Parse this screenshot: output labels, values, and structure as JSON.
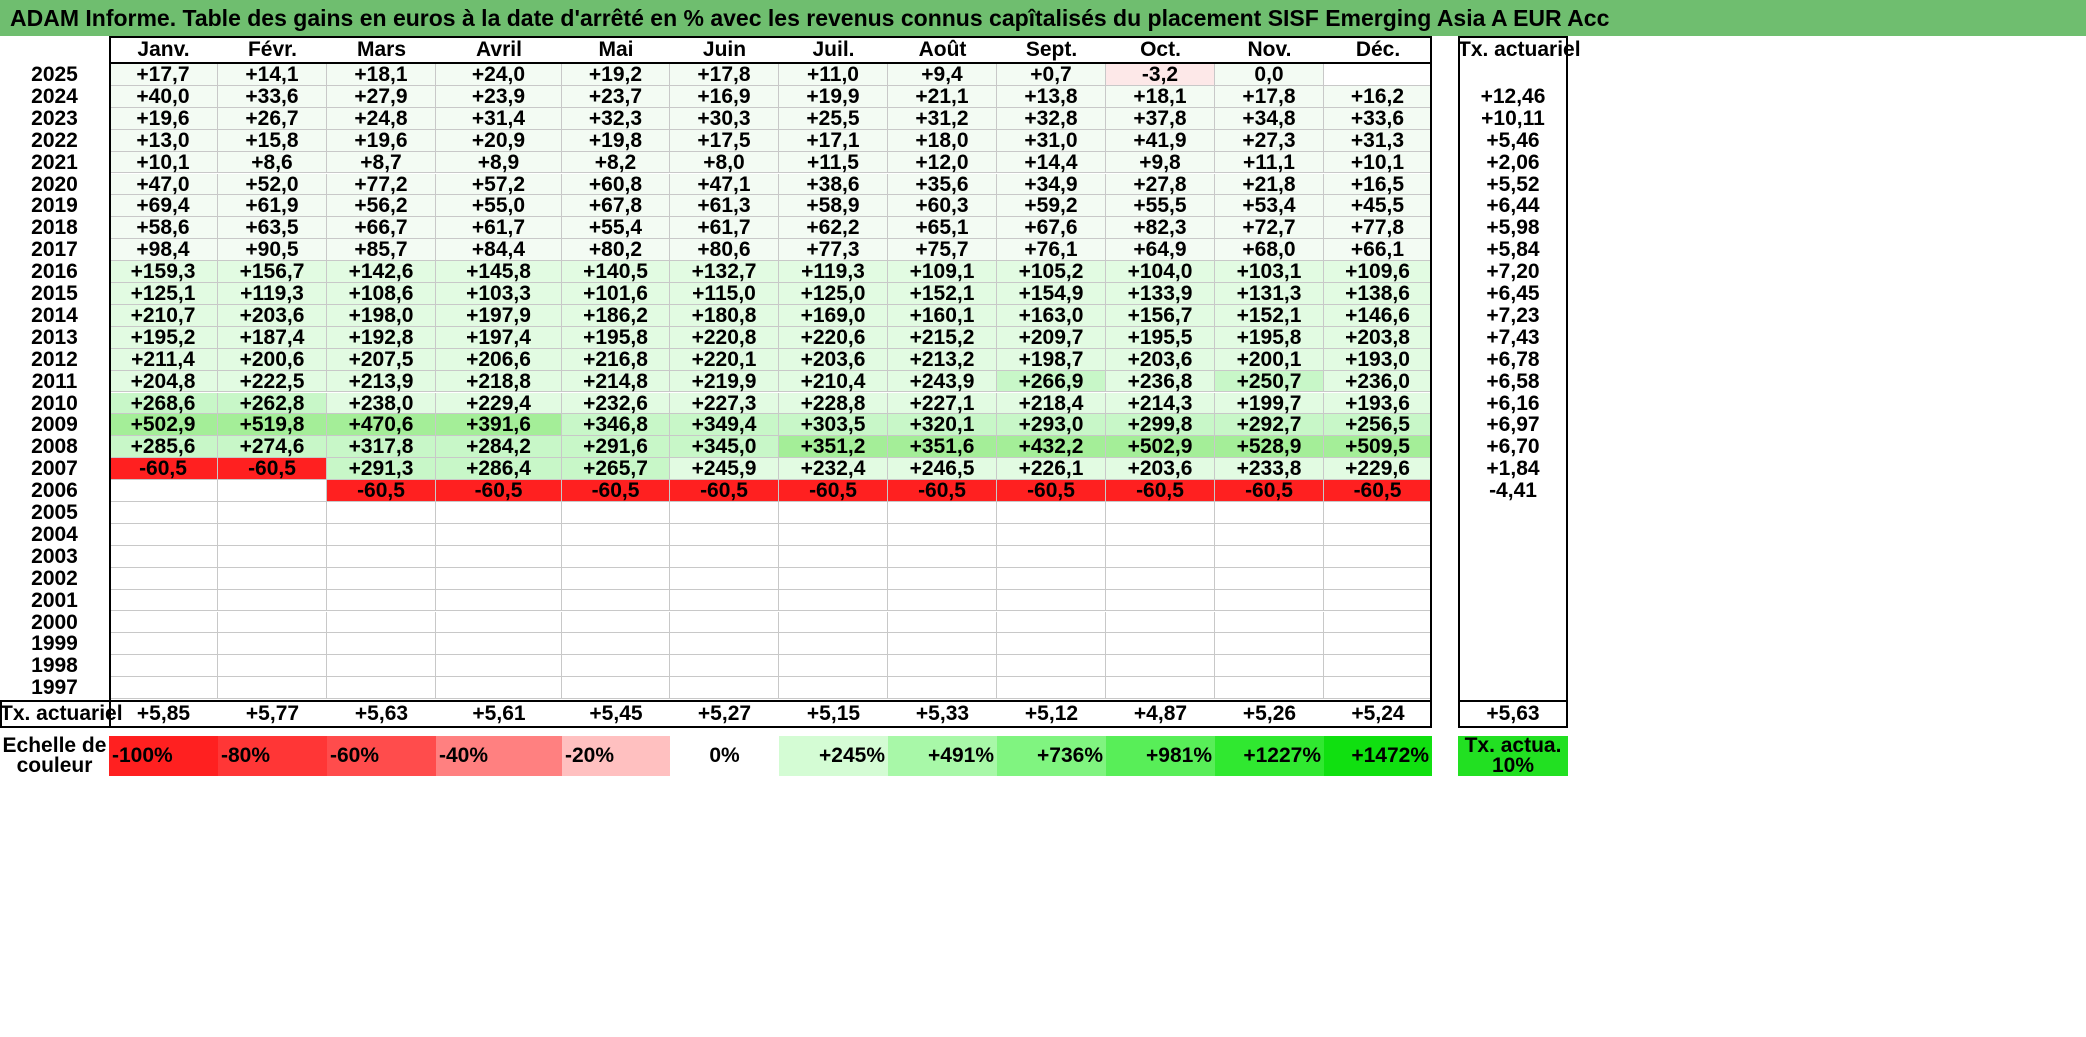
{
  "title": "ADAM Informe. Table des gains en euros à la date d'arrêté en % avec les revenus connus capîtalisés du placement SISF Emerging Asia A EUR Acc",
  "months": [
    "Janv.",
    "Févr.",
    "Mars",
    "Avril",
    "Mai",
    "Juin",
    "Juil.",
    "Août",
    "Sept.",
    "Oct.",
    "Nov.",
    "Déc."
  ],
  "rate_header": "Tx. actuariel",
  "rows": [
    {
      "year": "2025",
      "values": [
        "+17,7",
        "+14,1",
        "+18,1",
        "+24,0",
        "+19,2",
        "+17,8",
        "+11,0",
        "+9,4",
        "+0,7",
        "-3,2",
        "0,0",
        ""
      ],
      "rate": ""
    },
    {
      "year": "2024",
      "values": [
        "+40,0",
        "+33,6",
        "+27,9",
        "+23,9",
        "+23,7",
        "+16,9",
        "+19,9",
        "+21,1",
        "+13,8",
        "+18,1",
        "+17,8",
        "+16,2"
      ],
      "rate": "+12,46"
    },
    {
      "year": "2023",
      "values": [
        "+19,6",
        "+26,7",
        "+24,8",
        "+31,4",
        "+32,3",
        "+30,3",
        "+25,5",
        "+31,2",
        "+32,8",
        "+37,8",
        "+34,8",
        "+33,6"
      ],
      "rate": "+10,11"
    },
    {
      "year": "2022",
      "values": [
        "+13,0",
        "+15,8",
        "+19,6",
        "+20,9",
        "+19,8",
        "+17,5",
        "+17,1",
        "+18,0",
        "+31,0",
        "+41,9",
        "+27,3",
        "+31,3"
      ],
      "rate": "+5,46"
    },
    {
      "year": "2021",
      "values": [
        "+10,1",
        "+8,6",
        "+8,7",
        "+8,9",
        "+8,2",
        "+8,0",
        "+11,5",
        "+12,0",
        "+14,4",
        "+9,8",
        "+11,1",
        "+10,1"
      ],
      "rate": "+2,06"
    },
    {
      "year": "2020",
      "values": [
        "+47,0",
        "+52,0",
        "+77,2",
        "+57,2",
        "+60,8",
        "+47,1",
        "+38,6",
        "+35,6",
        "+34,9",
        "+27,8",
        "+21,8",
        "+16,5"
      ],
      "rate": "+5,52"
    },
    {
      "year": "2019",
      "values": [
        "+69,4",
        "+61,9",
        "+56,2",
        "+55,0",
        "+67,8",
        "+61,3",
        "+58,9",
        "+60,3",
        "+59,2",
        "+55,5",
        "+53,4",
        "+45,5"
      ],
      "rate": "+6,44"
    },
    {
      "year": "2018",
      "values": [
        "+58,6",
        "+63,5",
        "+66,7",
        "+61,7",
        "+55,4",
        "+61,7",
        "+62,2",
        "+65,1",
        "+67,6",
        "+82,3",
        "+72,7",
        "+77,8"
      ],
      "rate": "+5,98"
    },
    {
      "year": "2017",
      "values": [
        "+98,4",
        "+90,5",
        "+85,7",
        "+84,4",
        "+80,2",
        "+80,6",
        "+77,3",
        "+75,7",
        "+76,1",
        "+64,9",
        "+68,0",
        "+66,1"
      ],
      "rate": "+5,84"
    },
    {
      "year": "2016",
      "values": [
        "+159,3",
        "+156,7",
        "+142,6",
        "+145,8",
        "+140,5",
        "+132,7",
        "+119,3",
        "+109,1",
        "+105,2",
        "+104,0",
        "+103,1",
        "+109,6"
      ],
      "rate": "+7,20"
    },
    {
      "year": "2015",
      "values": [
        "+125,1",
        "+119,3",
        "+108,6",
        "+103,3",
        "+101,6",
        "+115,0",
        "+125,0",
        "+152,1",
        "+154,9",
        "+133,9",
        "+131,3",
        "+138,6"
      ],
      "rate": "+6,45"
    },
    {
      "year": "2014",
      "values": [
        "+210,7",
        "+203,6",
        "+198,0",
        "+197,9",
        "+186,2",
        "+180,8",
        "+169,0",
        "+160,1",
        "+163,0",
        "+156,7",
        "+152,1",
        "+146,6"
      ],
      "rate": "+7,23"
    },
    {
      "year": "2013",
      "values": [
        "+195,2",
        "+187,4",
        "+192,8",
        "+197,4",
        "+195,8",
        "+220,8",
        "+220,6",
        "+215,2",
        "+209,7",
        "+195,5",
        "+195,8",
        "+203,8"
      ],
      "rate": "+7,43"
    },
    {
      "year": "2012",
      "values": [
        "+211,4",
        "+200,6",
        "+207,5",
        "+206,6",
        "+216,8",
        "+220,1",
        "+203,6",
        "+213,2",
        "+198,7",
        "+203,6",
        "+200,1",
        "+193,0"
      ],
      "rate": "+6,78"
    },
    {
      "year": "2011",
      "values": [
        "+204,8",
        "+222,5",
        "+213,9",
        "+218,8",
        "+214,8",
        "+219,9",
        "+210,4",
        "+243,9",
        "+266,9",
        "+236,8",
        "+250,7",
        "+236,0"
      ],
      "rate": "+6,58"
    },
    {
      "year": "2010",
      "values": [
        "+268,6",
        "+262,8",
        "+238,0",
        "+229,4",
        "+232,6",
        "+227,3",
        "+228,8",
        "+227,1",
        "+218,4",
        "+214,3",
        "+199,7",
        "+193,6"
      ],
      "rate": "+6,16"
    },
    {
      "year": "2009",
      "values": [
        "+502,9",
        "+519,8",
        "+470,6",
        "+391,6",
        "+346,8",
        "+349,4",
        "+303,5",
        "+320,1",
        "+293,0",
        "+299,8",
        "+292,7",
        "+256,5"
      ],
      "rate": "+6,97"
    },
    {
      "year": "2008",
      "values": [
        "+285,6",
        "+274,6",
        "+317,8",
        "+284,2",
        "+291,6",
        "+345,0",
        "+351,2",
        "+351,6",
        "+432,2",
        "+502,9",
        "+528,9",
        "+509,5"
      ],
      "rate": "+6,70"
    },
    {
      "year": "2007",
      "values": [
        "-60,5",
        "-60,5",
        "+291,3",
        "+286,4",
        "+265,7",
        "+245,9",
        "+232,4",
        "+246,5",
        "+226,1",
        "+203,6",
        "+233,8",
        "+229,6"
      ],
      "rate": "+1,84"
    },
    {
      "year": "2006",
      "values": [
        "",
        "",
        "-60,5",
        "-60,5",
        "-60,5",
        "-60,5",
        "-60,5",
        "-60,5",
        "-60,5",
        "-60,5",
        "-60,5",
        "-60,5"
      ],
      "rate": "-4,41"
    },
    {
      "year": "2005",
      "values": [
        "",
        "",
        "",
        "",
        "",
        "",
        "",
        "",
        "",
        "",
        "",
        ""
      ],
      "rate": ""
    },
    {
      "year": "2004",
      "values": [
        "",
        "",
        "",
        "",
        "",
        "",
        "",
        "",
        "",
        "",
        "",
        ""
      ],
      "rate": ""
    },
    {
      "year": "2003",
      "values": [
        "",
        "",
        "",
        "",
        "",
        "",
        "",
        "",
        "",
        "",
        "",
        ""
      ],
      "rate": ""
    },
    {
      "year": "2002",
      "values": [
        "",
        "",
        "",
        "",
        "",
        "",
        "",
        "",
        "",
        "",
        "",
        ""
      ],
      "rate": ""
    },
    {
      "year": "2001",
      "values": [
        "",
        "",
        "",
        "",
        "",
        "",
        "",
        "",
        "",
        "",
        "",
        ""
      ],
      "rate": ""
    },
    {
      "year": "2000",
      "values": [
        "",
        "",
        "",
        "",
        "",
        "",
        "",
        "",
        "",
        "",
        "",
        ""
      ],
      "rate": ""
    },
    {
      "year": "1999",
      "values": [
        "",
        "",
        "",
        "",
        "",
        "",
        "",
        "",
        "",
        "",
        "",
        ""
      ],
      "rate": ""
    },
    {
      "year": "1998",
      "values": [
        "",
        "",
        "",
        "",
        "",
        "",
        "",
        "",
        "",
        "",
        "",
        ""
      ],
      "rate": ""
    },
    {
      "year": "1997",
      "values": [
        "",
        "",
        "",
        "",
        "",
        "",
        "",
        "",
        "",
        "",
        "",
        ""
      ],
      "rate": ""
    }
  ],
  "summary": {
    "label": "Tx. actuariel",
    "values": [
      "+5,85",
      "+5,77",
      "+5,63",
      "+5,61",
      "+5,45",
      "+5,27",
      "+5,15",
      "+5,33",
      "+5,12",
      "+4,87",
      "+5,26",
      "+5,24"
    ],
    "total": "+5,63"
  },
  "scale": {
    "label": "Echelle de couleur",
    "items": [
      {
        "text": "-100%",
        "color": "#ff2020"
      },
      {
        "text": "-80%",
        "color": "#ff3636"
      },
      {
        "text": "-60%",
        "color": "#ff4c4c"
      },
      {
        "text": "-40%",
        "color": "#ff8080"
      },
      {
        "text": "-20%",
        "color": "#ffc0c0"
      },
      {
        "text": "0%",
        "color": "#ffffff"
      },
      {
        "text": "+245%",
        "color": "#d4fcd4"
      },
      {
        "text": "+491%",
        "color": "#a8f8a8"
      },
      {
        "text": "+736%",
        "color": "#80f480"
      },
      {
        "text": "+981%",
        "color": "#58ee58"
      },
      {
        "text": "+1227%",
        "color": "#30e830"
      },
      {
        "text": "+1472%",
        "color": "#10e010"
      }
    ],
    "rate_label": "Tx. actua. 10%",
    "rate_color": "#22e022"
  },
  "colors": {
    "title_bg": "#6fbe6f",
    "neg_strong": "#ff2020",
    "neg_light": "#fde8e8",
    "pos_faint": "#f3fbf3",
    "pos_light": "#e2fbe2",
    "pos_mid": "#c8f7c8",
    "pos_strong": "#a4ee98"
  }
}
